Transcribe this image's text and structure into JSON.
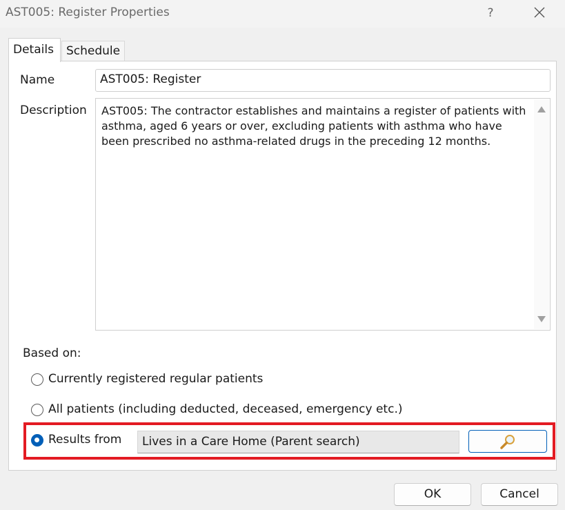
{
  "window": {
    "title": "AST005: Register Properties",
    "help_label": "?"
  },
  "tabs": [
    {
      "label": "Details",
      "active": true
    },
    {
      "label": "Schedule",
      "active": false
    }
  ],
  "details": {
    "name_label": "Name",
    "name_value": "AST005: Register",
    "description_label": "Description",
    "description_value": "AST005: The contractor establishes and maintains a register of patients with asthma, aged 6 years or over, excluding patients with asthma who have been prescribed no asthma-related drugs in the preceding 12 months."
  },
  "based_on": {
    "label": "Based on:",
    "options": [
      {
        "label": "Currently registered regular patients",
        "selected": false
      },
      {
        "label": "All patients (including deducted, deceased, emergency etc.)",
        "selected": false
      },
      {
        "label": "Results from",
        "selected": true
      }
    ],
    "results_value": "Lives in a Care Home (Parent search)"
  },
  "buttons": {
    "ok": "OK",
    "cancel": "Cancel"
  },
  "colors": {
    "accent": "#005fb8",
    "highlight": "#e31b23",
    "search_icon": "#d9a13b"
  },
  "icons": {
    "close": "close-icon",
    "search": "magnifier-icon",
    "scroll_up": "scroll-up-arrow",
    "scroll_down": "scroll-down-arrow"
  }
}
